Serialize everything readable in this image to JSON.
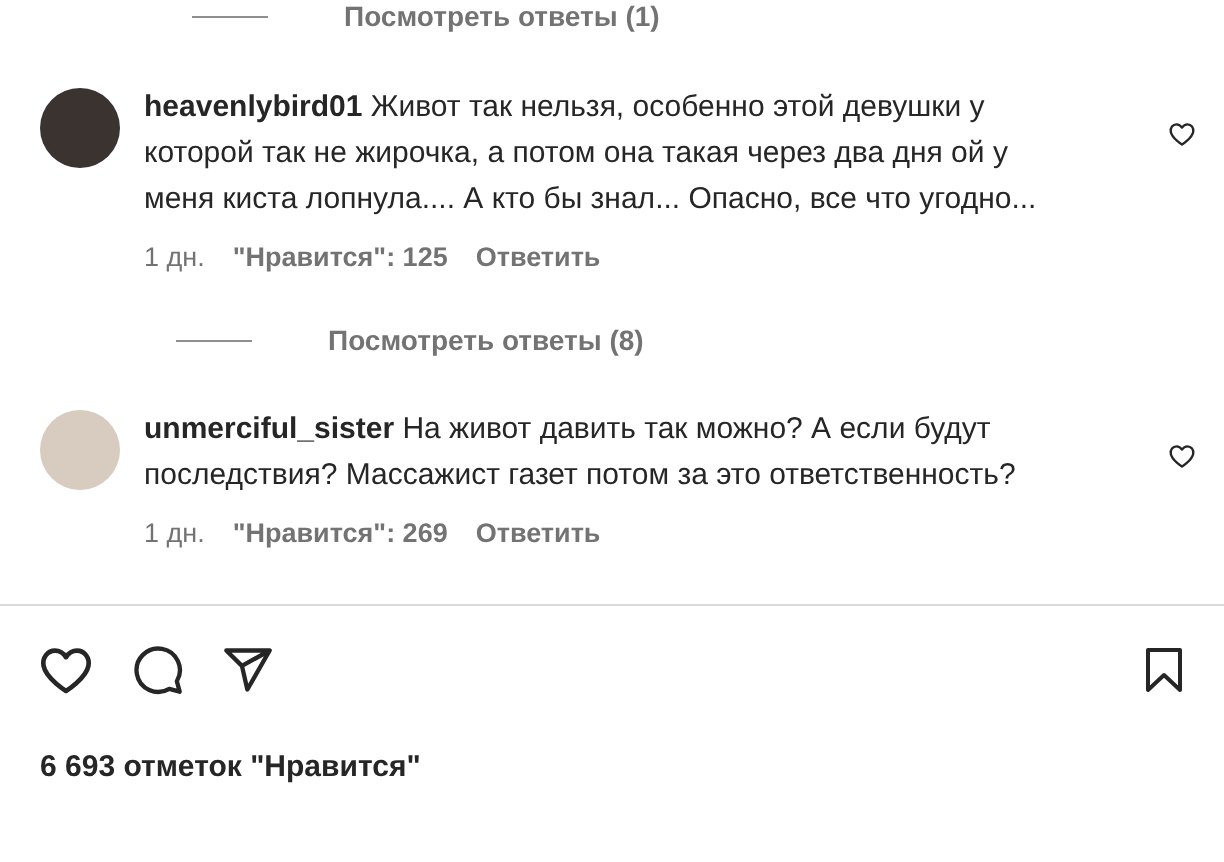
{
  "top_replies_link": {
    "label": "Посмотреть ответы (1)"
  },
  "comments": [
    {
      "username": "heavenlybird01",
      "text": "Живот так нельзя, особенно этой девушки у которой так не жирочка, а потом она такая через два дня ой у меня киста лопнула.... А кто бы знал... Опасно, все что угодно...",
      "age": "1 дн.",
      "likes": "\"Нравится\": 125",
      "reply": "Ответить",
      "liked": false,
      "replies_link": "Посмотреть ответы (8)"
    },
    {
      "username": "unmerciful_sister",
      "text": "На живот давить так можно? А если будут последствия? Массажист газет потом за это ответственность?",
      "age": "1 дн.",
      "likes": "\"Нравится\": 269",
      "reply": "Ответить",
      "liked": false
    }
  ],
  "actions": {
    "liked": false,
    "saved": false
  },
  "likes_count": "6 693 отметок \"Нравится\""
}
